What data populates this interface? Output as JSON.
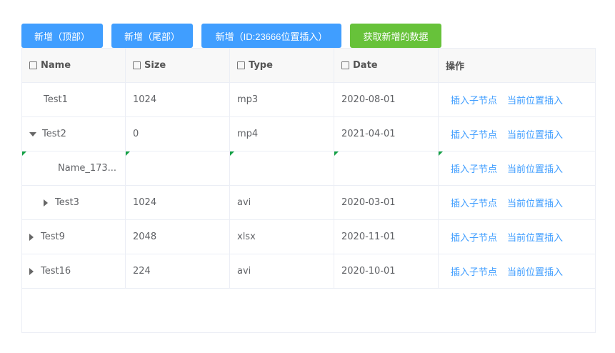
{
  "buttons": {
    "add_top": "新增（顶部）",
    "add_bottom": "新增（尾部）",
    "add_at": "新增（ID:23666位置插入）",
    "get_new": "获取新增的数据"
  },
  "columns": [
    "Name",
    "Size",
    "Type",
    "Date",
    "操作"
  ],
  "actions": {
    "insert_child": "插入子节点",
    "insert_here": "当前位置插入"
  },
  "rows": [
    {
      "name": "Test1",
      "size": "1024",
      "type": "mp3",
      "date": "2020-08-01"
    },
    {
      "name": "Test2",
      "size": "0",
      "type": "mp4",
      "date": "2021-04-01"
    },
    {
      "name": "Name_173...",
      "size": "",
      "type": "",
      "date": ""
    },
    {
      "name": "Test3",
      "size": "1024",
      "type": "avi",
      "date": "2020-03-01"
    },
    {
      "name": "Test9",
      "size": "2048",
      "type": "xlsx",
      "date": "2020-11-01"
    },
    {
      "name": "Test16",
      "size": "224",
      "type": "avi",
      "date": "2020-10-01"
    }
  ]
}
